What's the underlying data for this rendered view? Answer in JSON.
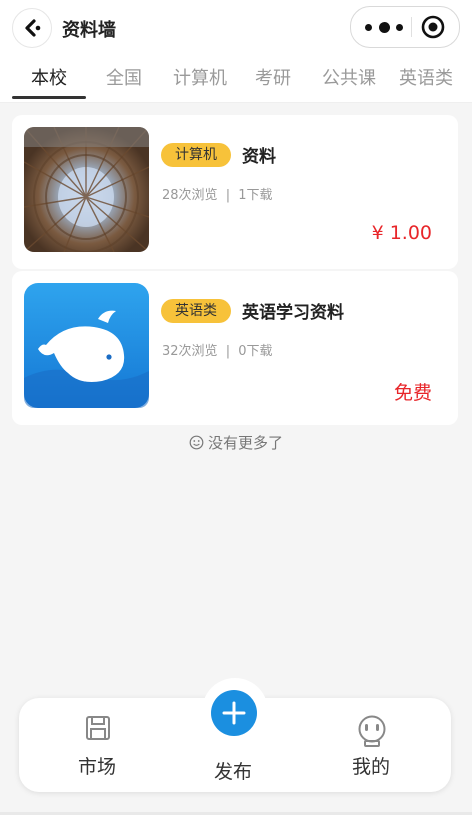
{
  "header": {
    "title": "资料墙"
  },
  "tabs": [
    {
      "label": "本校",
      "active": true
    },
    {
      "label": "全国"
    },
    {
      "label": "计算机"
    },
    {
      "label": "考研"
    },
    {
      "label": "公共课"
    },
    {
      "label": "英语类"
    }
  ],
  "items": [
    {
      "badge": "计算机",
      "title": "资料",
      "views": "28次浏览",
      "downloads": "1下载",
      "separator": "|",
      "price": "¥ 1.00",
      "thumb": "building-photo"
    },
    {
      "badge": "英语类",
      "title": "英语学习资料",
      "views": "32次浏览",
      "downloads": "0下载",
      "separator": "|",
      "price": "免费",
      "thumb": "whale-app-icon"
    }
  ],
  "footer_note": "没有更多了",
  "bottom_nav": {
    "market": "市场",
    "publish": "发布",
    "mine": "我的"
  },
  "colors": {
    "accent_blue": "#1b8fe0",
    "badge_yellow": "#f7c23a",
    "price_red": "#e8262a"
  }
}
